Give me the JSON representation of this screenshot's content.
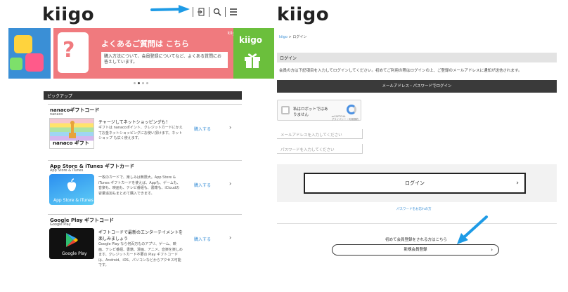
{
  "left_page": {
    "logo": "kiigo",
    "slider": {
      "main_title": "よくあるご質問は こちら",
      "main_subtitle": "購入方法について、会員登録についてなど、よくある質問にお答えしています。",
      "next_logo": "kiigo",
      "main_mark": "kiigo"
    },
    "pickup_label": "ピックアップ",
    "cards": [
      {
        "title": "nanacoギフトコード",
        "subtitle": "nanaco",
        "desc_lead": "チャージしてネットショッピングも！",
        "desc": "ギフトは nanacoポイント、クレジットカードにかえてお金ネットショッピングにお使い頂けます。ネットショップ も広く使えます。",
        "thumb_label": "nanaco ギフト",
        "buy_label": "購入する"
      },
      {
        "title": "App Store & iTunes ギフトカード",
        "subtitle": "App Store & iTunes",
        "desc_lead": "",
        "desc": "一枚のカードで、楽しみは無限大。App Store & iTunes ギフトカードを使えば、Appも、ゲームも、音楽も、映画も、テレビ番組も、書籍も、iCloudの容量追加もまとめて購入できます。",
        "thumb_label": "App Store & iTunes",
        "buy_label": "購入する"
      },
      {
        "title": "Google Play ギフトコード",
        "subtitle": "Google Play",
        "desc_lead": "ギフトコードで最新のエンターテイメントを楽しみましょう",
        "desc": "Google Play なら何百万ものアプリ、ゲーム、映画、テレビ番組、書籍、漫画、アニメ、音楽を楽しめます。クレジットカード不要の Play ギフトコードは、Android、iOS、パソコンなどからアクセス可能です。",
        "thumb_label": "Google Play",
        "buy_label": "購入する"
      }
    ]
  },
  "right_page": {
    "logo": "kiigo",
    "breadcrumb": {
      "home": "kiigo",
      "separator": ">",
      "current": "ログイン"
    },
    "section_title": "ログイン",
    "intro": "会員の方は下記項目を入力してログインしてください。初めてご利用の際はログインの上、ご登録のメールアドレスに通知が送信されます。",
    "form_header": "メールアドレス・パスワードでログイン",
    "captcha": {
      "label": "私はロボットではありません",
      "brand": "reCAPTCHA",
      "links": "プライバシー・利用規約"
    },
    "email_placeholder": "メールアドレスを入力してください",
    "password_placeholder": "パスワードを入力してください",
    "login_button": "ログイン",
    "forgot_link": "パスワードをお忘れの方",
    "first_time_text": "初めて会員登録をされる方はこちら",
    "register_button": "新規会員登録"
  },
  "colors": {
    "accent_blue": "#3a8fd6",
    "slide_pink": "#f07a7e",
    "dark_bar": "#3a3a3a",
    "arrow_blue": "#1e9be6"
  }
}
